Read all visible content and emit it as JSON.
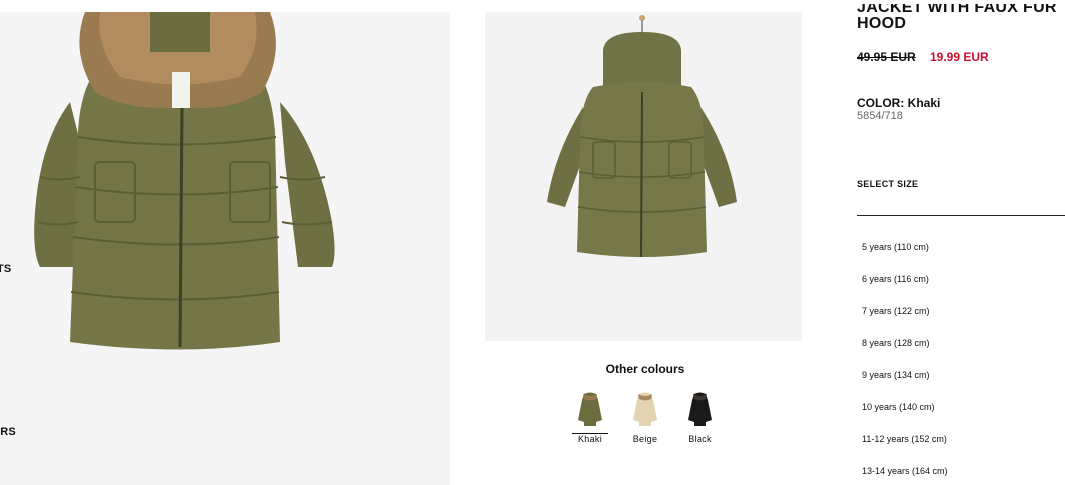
{
  "nav": {
    "items": [
      {
        "label": "S"
      },
      {
        "label": "SUITS"
      },
      {
        "label": "S"
      },
      {
        "label": "USERS"
      }
    ]
  },
  "product": {
    "title_line1": "JACKET WITH FAUX FUR",
    "title_line2": "HOOD",
    "price_old": "49.95 EUR",
    "price_new": "19.99 EUR",
    "color_label": "COLOR: Khaki",
    "reference": "5854/718",
    "accent_color": "#c8102e"
  },
  "other_colours": {
    "title": "Other colours",
    "swatches": [
      {
        "label": "Khaki",
        "color": "#6b6d3f",
        "selected": true
      },
      {
        "label": "Beige",
        "color": "#e3d3b1",
        "selected": false
      },
      {
        "label": "Black",
        "color": "#1a1a1a",
        "selected": false
      }
    ]
  },
  "sizes": {
    "label": "SELECT SIZE",
    "options": [
      "5 years (110 cm)",
      "6 years (116 cm)",
      "7 years (122 cm)",
      "8 years (128 cm)",
      "9 years (134 cm)",
      "10 years (140 cm)",
      "11-12 years (152 cm)",
      "13-14 years (164 cm)"
    ]
  }
}
